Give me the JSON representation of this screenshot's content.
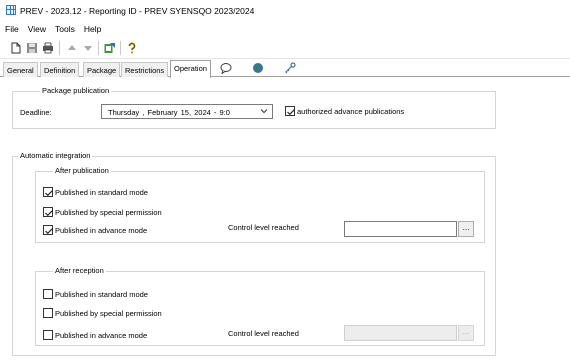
{
  "window": {
    "title": "PREV - 2023.12 - Reporting ID - PREV SYENSQO 2023/2024"
  },
  "menu": [
    "File",
    "View",
    "Tools",
    "Help"
  ],
  "toolbar": {
    "buttons": [
      "new-document-icon",
      "save-icon",
      "print-icon",
      "arrow-up-icon",
      "arrow-down-icon",
      "export-icon",
      "help-icon"
    ]
  },
  "tabs": [
    "General",
    "Definition",
    "Package",
    "Restrictions",
    "Operation"
  ],
  "tab_icons": [
    "comment-icon",
    "globe-icon",
    "key-icon"
  ],
  "active_tab": "Operation",
  "package_publication": {
    "legend": "Package publication",
    "deadline_label": "Deadline:",
    "deadline_value": "Thursday , February 15, 2024 - 9:0",
    "authorized_label": "authorized advance publications",
    "authorized_checked": true
  },
  "automatic_integration": {
    "legend": "Automatic integration",
    "after_publication": {
      "legend": "After publication",
      "options": [
        {
          "label": "Published in standard mode",
          "checked": true
        },
        {
          "label": "Published by special permission",
          "checked": true
        },
        {
          "label": "Published in advance mode",
          "checked": true
        }
      ],
      "control_label": "Control level reached",
      "control_value": "",
      "browse_label": "..."
    },
    "after_reception": {
      "legend": "After reception",
      "options": [
        {
          "label": "Published in standard mode",
          "checked": false
        },
        {
          "label": "Published by special permission",
          "checked": false
        },
        {
          "label": "Published in advance mode",
          "checked": false
        }
      ],
      "control_label": "Control level reached",
      "control_value": "",
      "browse_label": "..."
    }
  }
}
